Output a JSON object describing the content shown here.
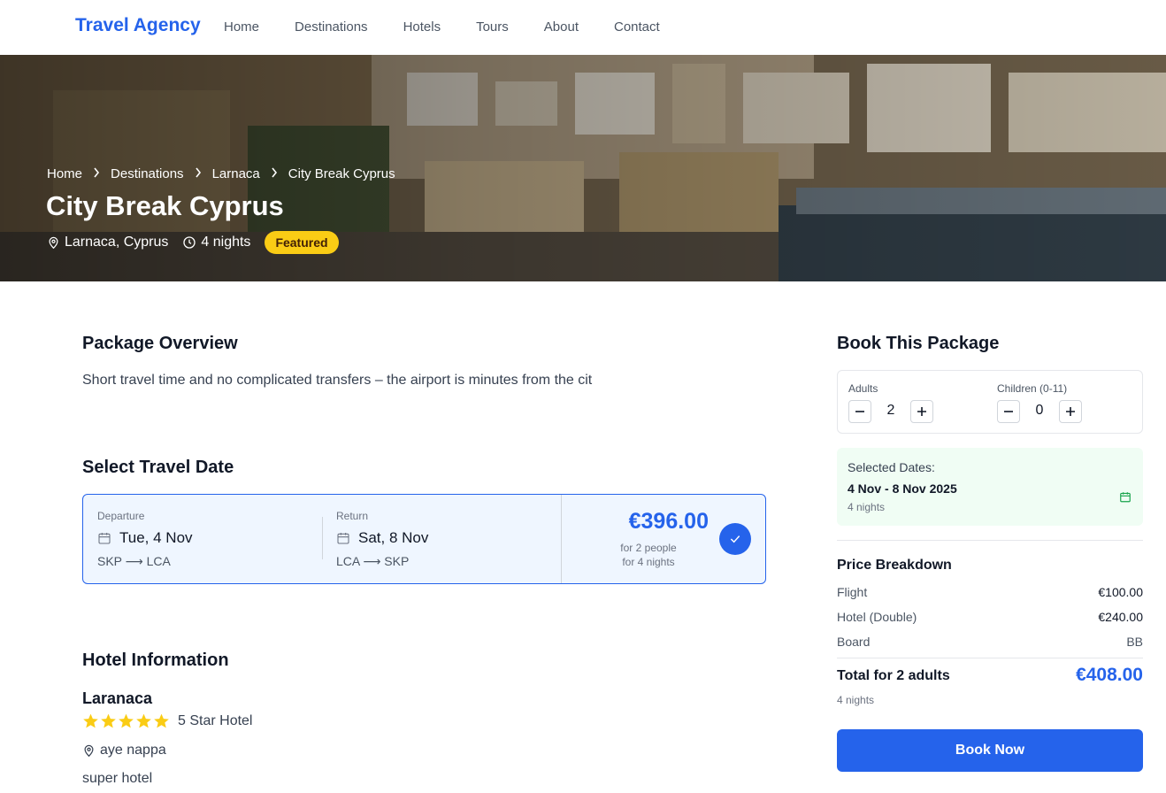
{
  "nav": {
    "brand": "Travel Agency",
    "links": [
      "Home",
      "Destinations",
      "Hotels",
      "Tours",
      "About",
      "Contact"
    ]
  },
  "hero": {
    "breadcrumb": [
      "Home",
      "Destinations",
      "Larnaca",
      "City Break Cyprus"
    ],
    "title": "City Break Cyprus",
    "location": "Larnaca, Cyprus",
    "duration": "4 nights",
    "badge": "Featured"
  },
  "overview": {
    "title": "Package Overview",
    "text": "Short travel time and no complicated transfers – the airport is minutes from the cit"
  },
  "travel_date": {
    "title": "Select Travel Date",
    "departure_label": "Departure",
    "departure_date": "Tue, 4 Nov",
    "departure_route": "SKP ⟶ LCA",
    "return_label": "Return",
    "return_date": "Sat, 8 Nov",
    "return_route": "LCA ⟶ SKP",
    "price": "€396.00",
    "price_people": "for 2 people",
    "price_nights": "for 4 nights"
  },
  "hotel": {
    "title": "Hotel Information",
    "name": "Laranaca",
    "stars": 5,
    "star_text": "5 Star Hotel",
    "location": "aye nappa",
    "description": "super hotel"
  },
  "booking": {
    "title": "Book This Package",
    "adults_label": "Adults",
    "adults_value": "2",
    "children_label": "Children (0-11)",
    "children_value": "0",
    "selected_label": "Selected Dates:",
    "selected_dates": "4 Nov - 8 Nov 2025",
    "selected_nights": "4 nights",
    "breakdown_title": "Price Breakdown",
    "flight_label": "Flight",
    "flight_value": "€100.00",
    "hotel_label": "Hotel (Double)",
    "hotel_value": "€240.00",
    "board_label": "Board",
    "board_value": "BB",
    "total_label": "Total for 2 adults",
    "total_value": "€408.00",
    "total_nights": "4 nights",
    "book_button": "Book Now"
  },
  "colors": {
    "primary": "#2563eb",
    "badge": "#facc15",
    "selected_bg": "#f0fdf4",
    "star": "#facc15"
  }
}
